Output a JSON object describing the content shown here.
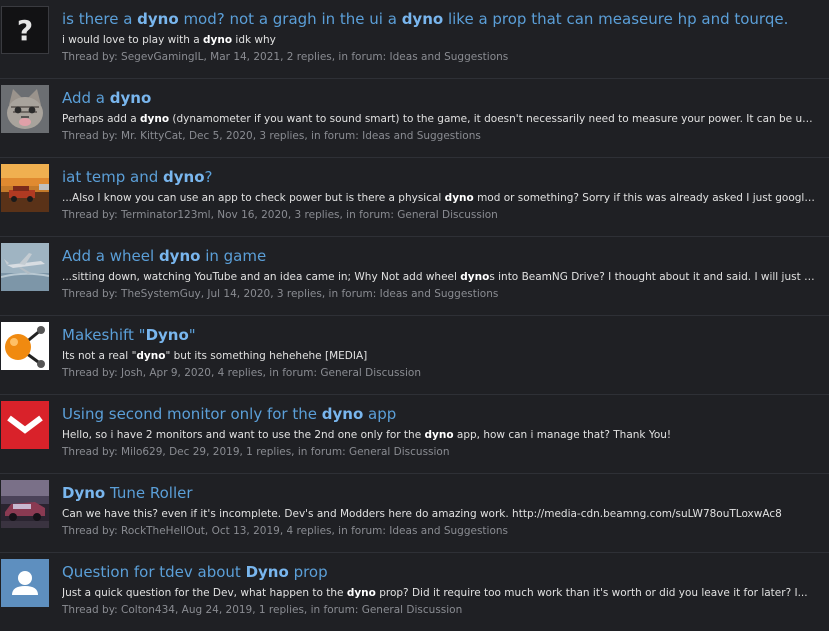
{
  "results": [
    {
      "avatar": "question-mark-icon",
      "title": [
        "is there a ",
        "dyno",
        " mod? not a gragh in the ui a ",
        "dyno",
        " like a prop that can measeure hp and tourqe."
      ],
      "snippet": [
        "i would love to play with a ",
        "dyno",
        " idk why"
      ],
      "thread_by": "Thread by: ",
      "author": "SegevGamingIL",
      "info": ", Mar 14, 2021, 2 replies, in forum: ",
      "forum": "Ideas and Suggestions"
    },
    {
      "avatar": "kitten-photo",
      "title": [
        "Add a ",
        "dyno",
        "",
        "",
        ""
      ],
      "snippet": [
        "Perhaps add a ",
        "dyno",
        " (dynamometer if you want to sound smart) to the game, it doesn't necessarily need to measure your power. It can be used in..."
      ],
      "thread_by": "Thread by: ",
      "author": "Mr. KittyCat",
      "info": ", Dec 5, 2020, 3 replies, in forum: ",
      "forum": "Ideas and Suggestions"
    },
    {
      "avatar": "sunset-car-photo",
      "title": [
        "iat temp and ",
        "dyno",
        "?",
        "",
        ""
      ],
      "snippet": [
        "...Also I know you can use an app to check power but is there a physical ",
        "dyno",
        " mod or something? Sorry if this was already asked I just google it..."
      ],
      "thread_by": "Thread by: ",
      "author": "Terminator123ml",
      "info": ", Nov 16, 2020, 3 replies, in forum: ",
      "forum": "General Discussion"
    },
    {
      "avatar": "jet-plane-photo",
      "title": [
        "Add a wheel ",
        "dyno",
        " in game",
        "",
        ""
      ],
      "snippet": [
        "...sitting down, watching YouTube and an idea came in; Why Not add wheel ",
        "dyno",
        "s into BeamNG Drive? I thought about it and said. I will just add..."
      ],
      "thread_by": "Thread by: ",
      "author": "TheSystemGuy",
      "info": ", Jul 14, 2020, 3 replies, in forum: ",
      "forum": "Ideas and Suggestions"
    },
    {
      "avatar": "molecule-icon",
      "title": [
        "Makeshift \"",
        "Dyno",
        "\"",
        "",
        ""
      ],
      "snippet": [
        "Its not a real \"",
        "dyno",
        "\" but its something hehehehe [MEDIA]"
      ],
      "thread_by": "Thread by: ",
      "author": "Josh",
      "info": ", Apr 9, 2020, 4 replies, in forum: ",
      "forum": "General Discussion"
    },
    {
      "avatar": "red-chevron-logo",
      "title": [
        "Using second monitor only for the ",
        "dyno",
        " app",
        "",
        ""
      ],
      "snippet": [
        "Hello, so i have 2 monitors and want to use the 2nd one only for the ",
        "dyno",
        " app, how can i manage that? Thank You!"
      ],
      "thread_by": "Thread by: ",
      "author": "Milo629",
      "info": ", Dec 29, 2019, 1 replies, in forum: ",
      "forum": "General Discussion"
    },
    {
      "avatar": "car-render-photo",
      "title": [
        "",
        "Dyno",
        " Tune Roller",
        "",
        ""
      ],
      "snippet": [
        "Can we have this? even if it's incomplete. Dev's and Modders here do amazing work. http://media-cdn.beamng.com/suLW78ouTLoxwAc8",
        "",
        ""
      ],
      "thread_by": "Thread by: ",
      "author": "RockTheHellOut",
      "info": ", Oct 13, 2019, 4 replies, in forum: ",
      "forum": "Ideas and Suggestions"
    },
    {
      "avatar": "default-user-icon",
      "title": [
        "Question for tdev about ",
        "Dyno",
        " prop",
        "",
        ""
      ],
      "snippet": [
        "Just a quick question for the Dev, what happen to the ",
        "dyno",
        " prop? Did it require too much work than it's worth or did you leave it for later? I..."
      ],
      "thread_by": "Thread by: ",
      "author": "Colton434",
      "info": ", Aug 24, 2019, 1 replies, in forum: ",
      "forum": "General Discussion"
    }
  ]
}
